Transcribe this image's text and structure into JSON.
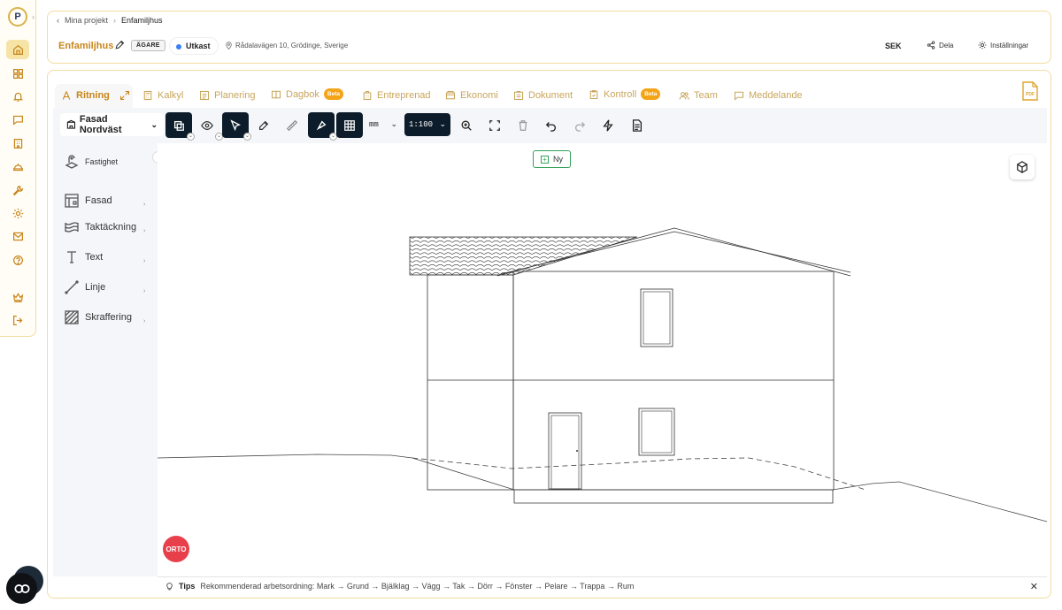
{
  "rail": {
    "logo": "P",
    "items": [
      {
        "name": "home-icon",
        "active": true
      },
      {
        "name": "grid-icon"
      },
      {
        "name": "bell-icon"
      },
      {
        "name": "chat-icon"
      },
      {
        "name": "building-icon"
      },
      {
        "name": "helmet-icon"
      },
      {
        "name": "wrench-icon"
      },
      {
        "name": "gear-icon"
      },
      {
        "name": "mail-icon"
      },
      {
        "name": "help-icon"
      },
      {
        "name": "crown-icon"
      },
      {
        "name": "logout-icon"
      }
    ]
  },
  "header": {
    "breadcrumb_root": "Mina projekt",
    "breadcrumb_current": "Enfamiljhus",
    "project_title": "Enfamiljhus",
    "owner_badge": "ÄGARE",
    "status": "Utkast",
    "status_color": "#3b7ff5",
    "address": "Rådalavägen 10, Grödinge, Sverige",
    "currency": "SEK",
    "share_label": "Dela",
    "settings_label": "Inställningar"
  },
  "tabs": [
    {
      "label": "Ritning",
      "active": true
    },
    {
      "label": "Kalkyl"
    },
    {
      "label": "Planering"
    },
    {
      "label": "Dagbok",
      "badge": "Beta"
    },
    {
      "label": "Entreprenad"
    },
    {
      "label": "Ekonomi"
    },
    {
      "label": "Dokument"
    },
    {
      "label": "Kontroll",
      "badge": "Beta"
    },
    {
      "label": "Team"
    },
    {
      "label": "Meddelande"
    }
  ],
  "toolbar": {
    "view_label": "Fasad Nordväst",
    "unit": "mm",
    "scale": "1:100"
  },
  "panel": {
    "items": [
      {
        "label": "Fastighet"
      },
      {
        "label": "Fasad"
      },
      {
        "label": "Taktäckning"
      },
      {
        "label": "Text"
      },
      {
        "label": "Linje"
      },
      {
        "label": "Skraffering"
      }
    ]
  },
  "canvas": {
    "new_label": "Ny",
    "orto_label": "ORTO"
  },
  "tips": {
    "label": "Tips",
    "text": "Rekommenderad arbetsordning: Mark → Grund → Bjälklag → Vägg → Tak → Dörr → Fönster → Pelare → Trappa → Rum"
  },
  "colors": {
    "accent": "#c8851a",
    "border": "#f3dca0",
    "dark": "#0c1c2a",
    "beta": "#f3a417"
  }
}
